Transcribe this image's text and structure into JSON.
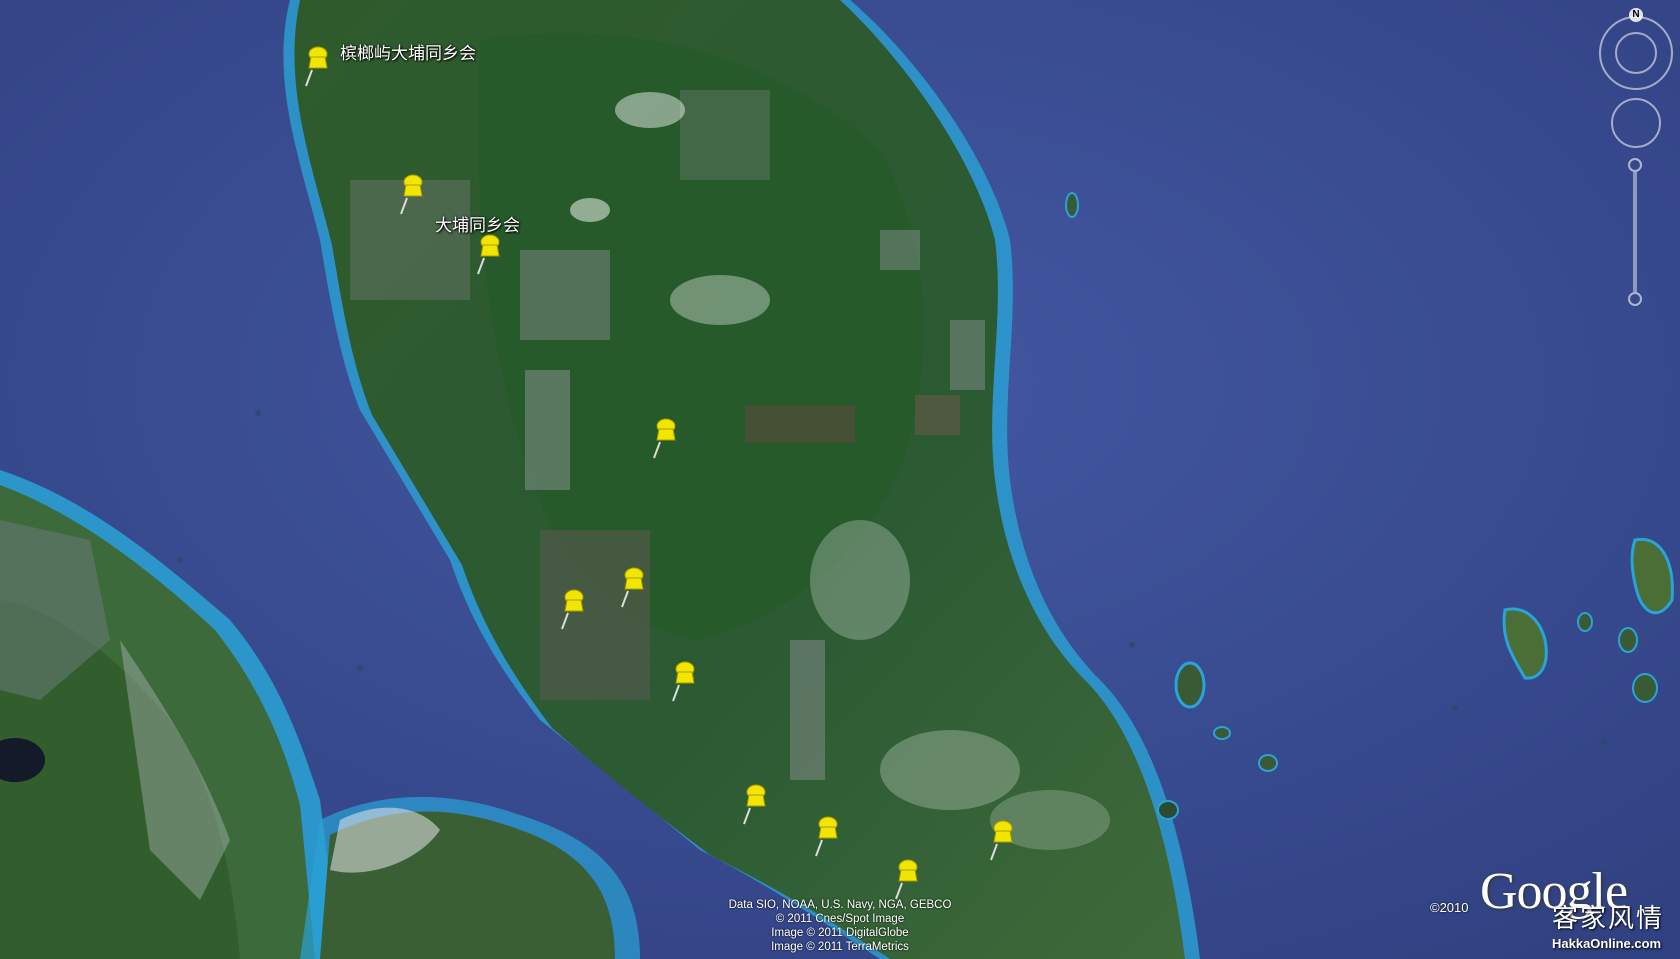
{
  "map": {
    "type": "satellite",
    "colors": {
      "ocean": "#3a4d93",
      "shallow": "#2aa3d6",
      "land": "#2c5a2e",
      "pin": "#f2e600"
    }
  },
  "placemarks": [
    {
      "label": "槟榔屿大埔同乡会",
      "icon": "pushpin-icon"
    },
    {
      "label": "",
      "icon": "pushpin-icon"
    },
    {
      "label": "大埔同乡会",
      "icon": "pushpin-icon"
    },
    {
      "label": "",
      "icon": "pushpin-icon"
    },
    {
      "label": "",
      "icon": "pushpin-icon"
    },
    {
      "label": "",
      "icon": "pushpin-icon"
    },
    {
      "label": "",
      "icon": "pushpin-icon"
    },
    {
      "label": "",
      "icon": "pushpin-icon"
    },
    {
      "label": "",
      "icon": "pushpin-icon"
    },
    {
      "label": "",
      "icon": "pushpin-icon"
    },
    {
      "label": "",
      "icon": "pushpin-icon"
    }
  ],
  "attribution": {
    "lines": [
      "Data SIO, NOAA, U.S. Navy, NGA, GEBCO",
      "© 2011 Cnes/Spot Image",
      "Image © 2011 DigitalGlobe",
      "Image © 2011 TerraMetrics"
    ],
    "copyright": "©2010",
    "logo": "Google"
  },
  "watermark": {
    "text": "客家风情",
    "url": "HakkaOnline.com"
  },
  "navigation": {
    "north_label": "N",
    "icons": [
      "compass-icon",
      "look-joystick-icon",
      "zoom-slider-icon"
    ]
  }
}
